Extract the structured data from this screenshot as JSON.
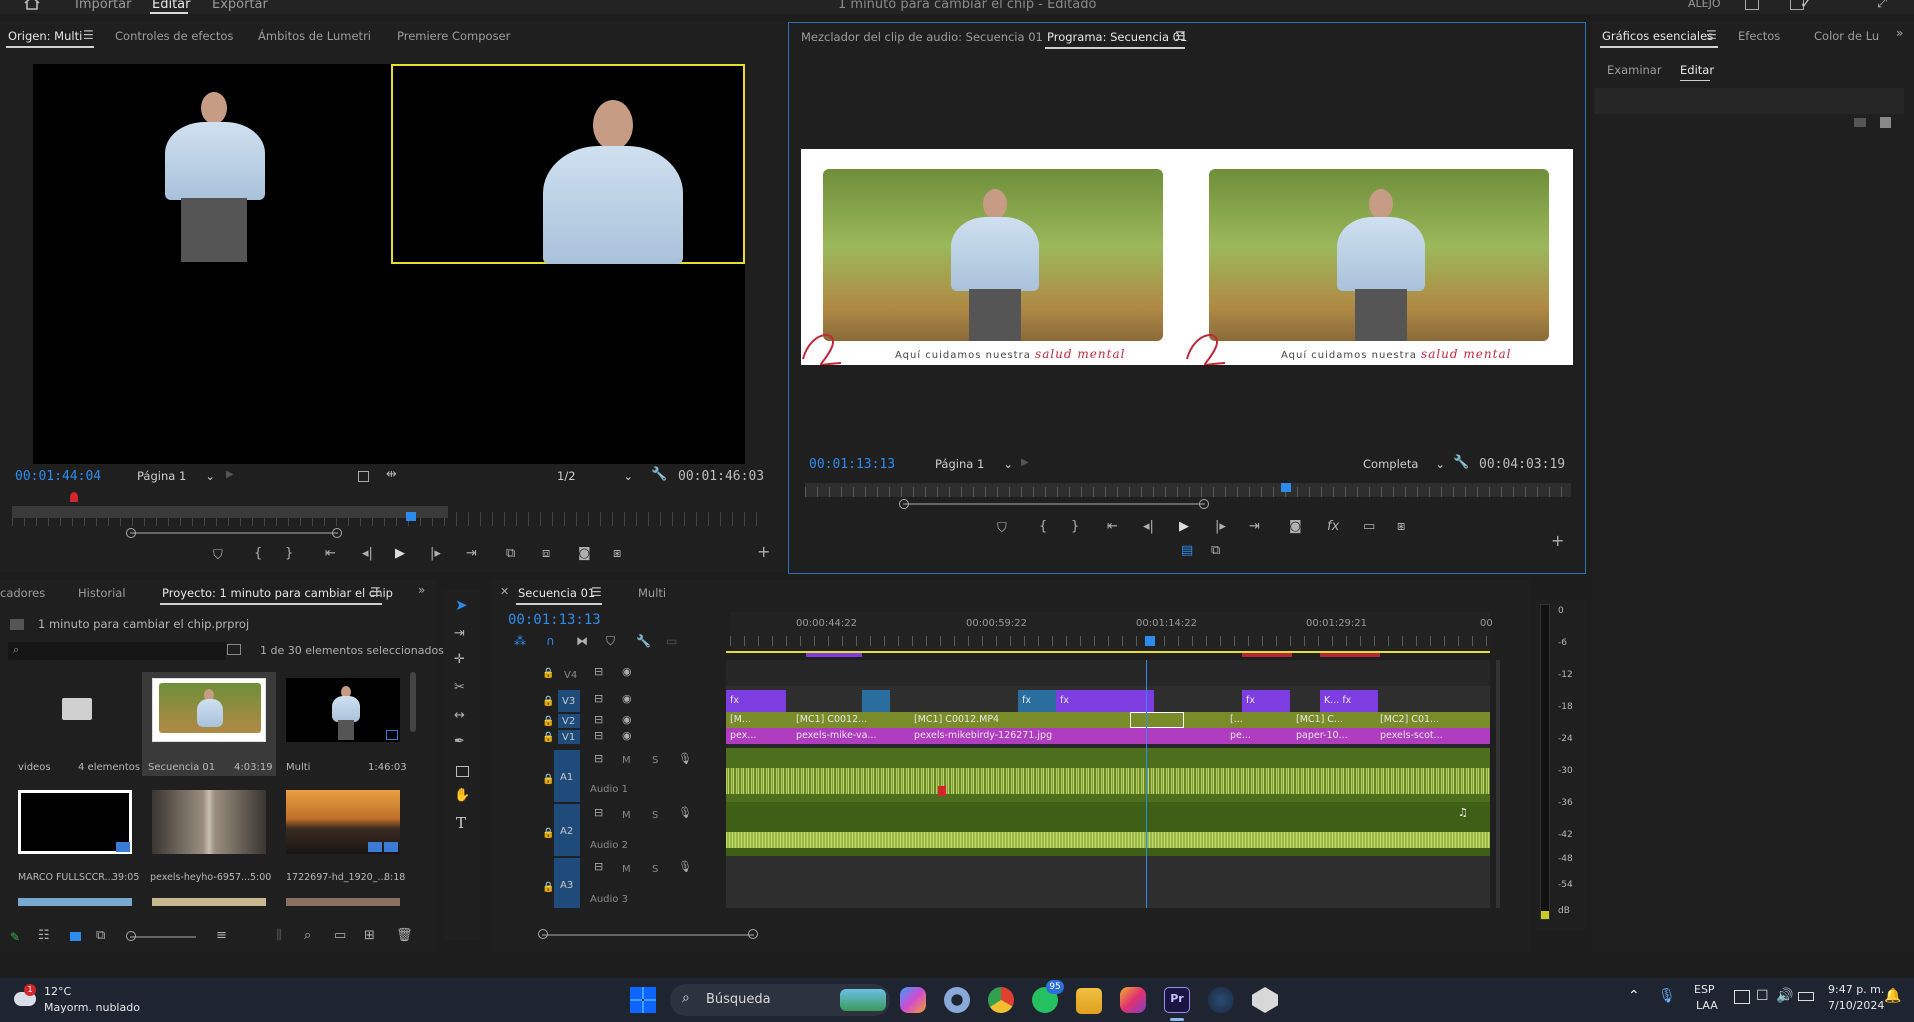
{
  "topbar": {
    "nav": [
      "Importar",
      "Editar",
      "Exportar"
    ],
    "project_title": "1 minuto para cambiar el chip",
    "edited_status": "Editado",
    "user": "ALEJO"
  },
  "source_panel": {
    "tabs": [
      "Origen: Multi",
      "Controles de efectos",
      "Ámbitos de Lumetri",
      "Premiere Composer"
    ],
    "timecode": "00:01:44:04",
    "page_dropdown": "Página 1",
    "resolution": "1/2",
    "duration": "00:01:46:03"
  },
  "program_panel": {
    "tabs": [
      "Mezclador del clip de audio: Secuencia 01",
      "Programa: Secuencia 01"
    ],
    "caption_prefix": "Aquí cuidamos nuestra",
    "caption_script": "salud mental",
    "timecode": "00:01:13:13",
    "page_dropdown": "Página 1",
    "quality": "Completa",
    "duration": "00:04:03:19",
    "playhead_fraction": 0.63
  },
  "essential_panel": {
    "tabs": [
      "Gráficos esenciales",
      "Efectos",
      "Color de Lu"
    ],
    "subtabs": [
      "Examinar",
      "Editar"
    ]
  },
  "project_panel": {
    "tabs": [
      "cadores",
      "Historial",
      "Proyecto: 1 minuto para cambiar el chip"
    ],
    "file": "1 minuto para cambiar el chip.prproj",
    "selection_count": "1 de 30 elementos seleccionados",
    "items": [
      {
        "name": "videos",
        "info": "4 elementos"
      },
      {
        "name": "Secuencia 01",
        "info": "4:03:19"
      },
      {
        "name": "Multi",
        "info": "1:46:03"
      },
      {
        "name": "MARCO FULLSCCR...",
        "info": "39:05"
      },
      {
        "name": "pexels-heyho-6957...",
        "info": "5:00"
      },
      {
        "name": "1722697-hd_1920_...",
        "info": "8:18"
      }
    ]
  },
  "timeline": {
    "tabs": [
      "Secuencia 01",
      "Multi"
    ],
    "timecode": "00:01:13:13",
    "ruler_labels": [
      "00:00:44:22",
      "00:00:59:22",
      "00:01:14:22",
      "00:01:29:21",
      "00"
    ],
    "video_tracks": [
      "V4",
      "V3",
      "V2",
      "V1"
    ],
    "audio_tracks": [
      {
        "id": "A1",
        "name": "Audio 1"
      },
      {
        "id": "A2",
        "name": "Audio 2"
      },
      {
        "id": "A3",
        "name": "Audio 3"
      }
    ],
    "track_buttons": [
      "M",
      "S"
    ],
    "v2_clips": [
      "[M...",
      "[MC1] C0012...",
      "[MC1] C0012.MP4",
      "[...",
      "[MC1] C...",
      "[MC2] C01..."
    ],
    "v1_clips": [
      "pex...",
      "pexels-mike-va...",
      "pexels-mikebirdy-126271.jpg",
      "pe...",
      "paper-10...",
      "pexels-scot..."
    ],
    "v3_clips": [
      "fx",
      "fx",
      "fx",
      "fx",
      "fx",
      "K..."
    ],
    "fx_label": "fx",
    "meter_scale": [
      "0",
      "-6",
      "-12",
      "-18",
      "-24",
      "-30",
      "-36",
      "-42",
      "-48",
      "-54",
      "dB"
    ]
  },
  "taskbar": {
    "temperature": "12°C",
    "weather": "Mayorm. nublado",
    "weather_badge": "1",
    "search": "Búsqueda",
    "whatsapp_badge": "95",
    "language": "ESP",
    "region": "LAA",
    "time": "9:47 p. m.",
    "date": "7/10/2024"
  },
  "colors": {
    "accent_blue": "#2d8ceb",
    "clip_green": "#7a8b2a",
    "clip_magenta": "#b03cc0",
    "clip_purple": "#7d3de0",
    "audio_green": "#4d6e1c",
    "selection_yellow": "#e6e02a"
  }
}
